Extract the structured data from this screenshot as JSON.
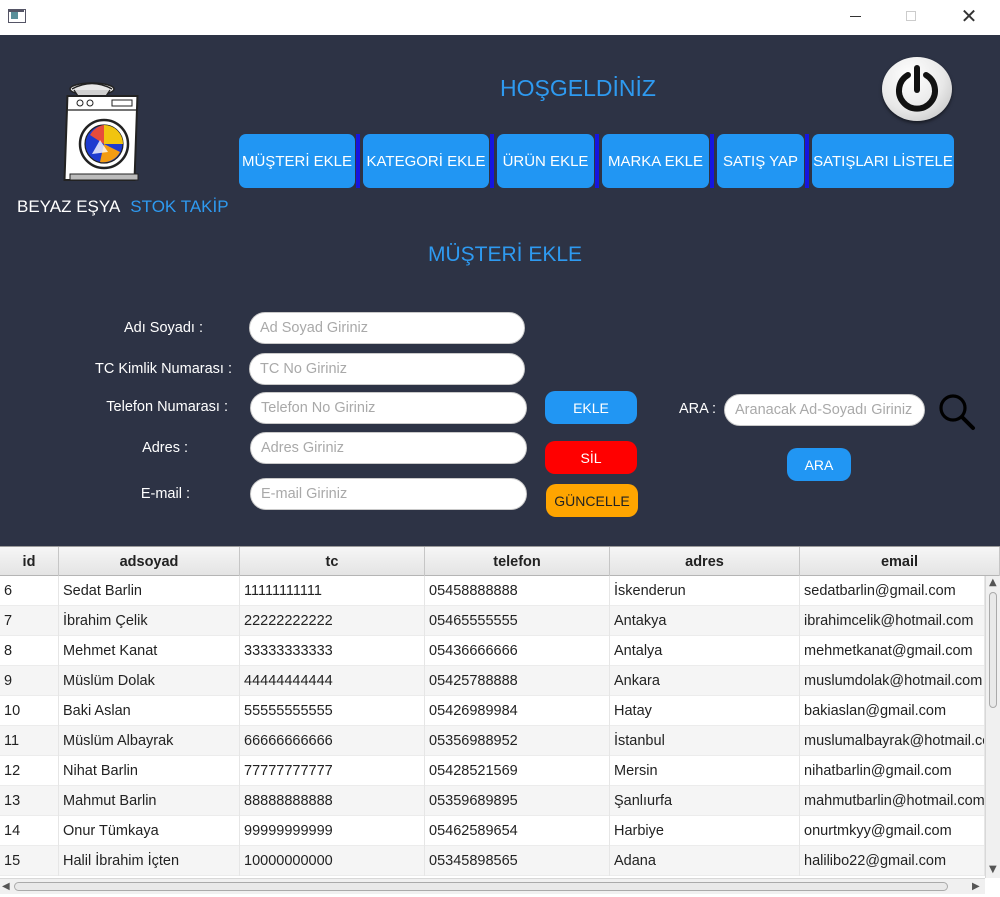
{
  "window": {
    "min_icon": "minimize-icon",
    "max_icon": "maximize-icon",
    "close_glyph": "✕"
  },
  "brand": {
    "part1": "BEYAZ EŞYA",
    "part2": "STOK TAKİP"
  },
  "header": {
    "welcome": "HOŞGELDİNİZ"
  },
  "nav": {
    "musteri_ekle": "MÜŞTERİ EKLE",
    "kategori_ekle": "KATEGORİ EKLE",
    "urun_ekle": "ÜRÜN EKLE",
    "marka_ekle": "MARKA EKLE",
    "satis_yap": "SATIŞ YAP",
    "satislari_listele": "SATIŞLARI LİSTELE"
  },
  "section": {
    "title": "MÜŞTERİ EKLE"
  },
  "form": {
    "name_label": "Adı Soyadı :",
    "name_placeholder": "Ad Soyad Giriniz",
    "tc_label": "TC Kimlik Numarası :",
    "tc_placeholder": "TC No Giriniz",
    "phone_label": "Telefon Numarası :",
    "phone_placeholder": "Telefon No Giriniz",
    "address_label": "Adres :",
    "address_placeholder": "Adres Giriniz",
    "email_label": "E-mail :",
    "email_placeholder": "E-mail Giriniz"
  },
  "actions": {
    "ekle": "EKLE",
    "sil": "SİL",
    "guncelle": "GÜNCELLE"
  },
  "search": {
    "label": "ARA :",
    "placeholder": "Aranacak Ad-Soyadı Giriniz",
    "button": "ARA"
  },
  "colors": {
    "panel_bg": "#2d3345",
    "accent": "#2196f3",
    "danger": "#ff0000",
    "warning": "#ffa500",
    "nav_separator": "#1515e0"
  },
  "table": {
    "columns": [
      "id",
      "adsoyad",
      "tc",
      "telefon",
      "adres",
      "email"
    ],
    "rows": [
      [
        "6",
        "Sedat Barlin",
        "11111111111",
        "05458888888",
        "İskenderun",
        "sedatbarlin@gmail.com"
      ],
      [
        "7",
        "İbrahim Çelik",
        "22222222222",
        "05465555555",
        "Antakya",
        "ibrahimcelik@hotmail.com"
      ],
      [
        "8",
        "Mehmet Kanat",
        "33333333333",
        "05436666666",
        "Antalya",
        "mehmetkanat@gmail.com"
      ],
      [
        "9",
        "Müslüm Dolak",
        "44444444444",
        "05425788888",
        "Ankara",
        "muslumdolak@hotmail.com"
      ],
      [
        "10",
        "Baki Aslan",
        "55555555555",
        "05426989984",
        "Hatay",
        "bakiaslan@gmail.com"
      ],
      [
        "11",
        "Müslüm Albayrak",
        "66666666666",
        "05356988952",
        "İstanbul",
        "muslumalbayrak@hotmail.com"
      ],
      [
        "12",
        "Nihat Barlin",
        "77777777777",
        "05428521569",
        "Mersin",
        "nihatbarlin@gmail.com"
      ],
      [
        "13",
        "Mahmut Barlin",
        "88888888888",
        "05359689895",
        "Şanlıurfa",
        "mahmutbarlin@hotmail.com"
      ],
      [
        "14",
        "Onur Tümkaya",
        "99999999999",
        "05462589654",
        "Harbiye",
        "onurtmkyy@gmail.com"
      ],
      [
        "15",
        "Halil İbrahim İçten",
        "10000000000",
        "05345898565",
        "Adana",
        "halilibo22@gmail.com"
      ]
    ]
  }
}
